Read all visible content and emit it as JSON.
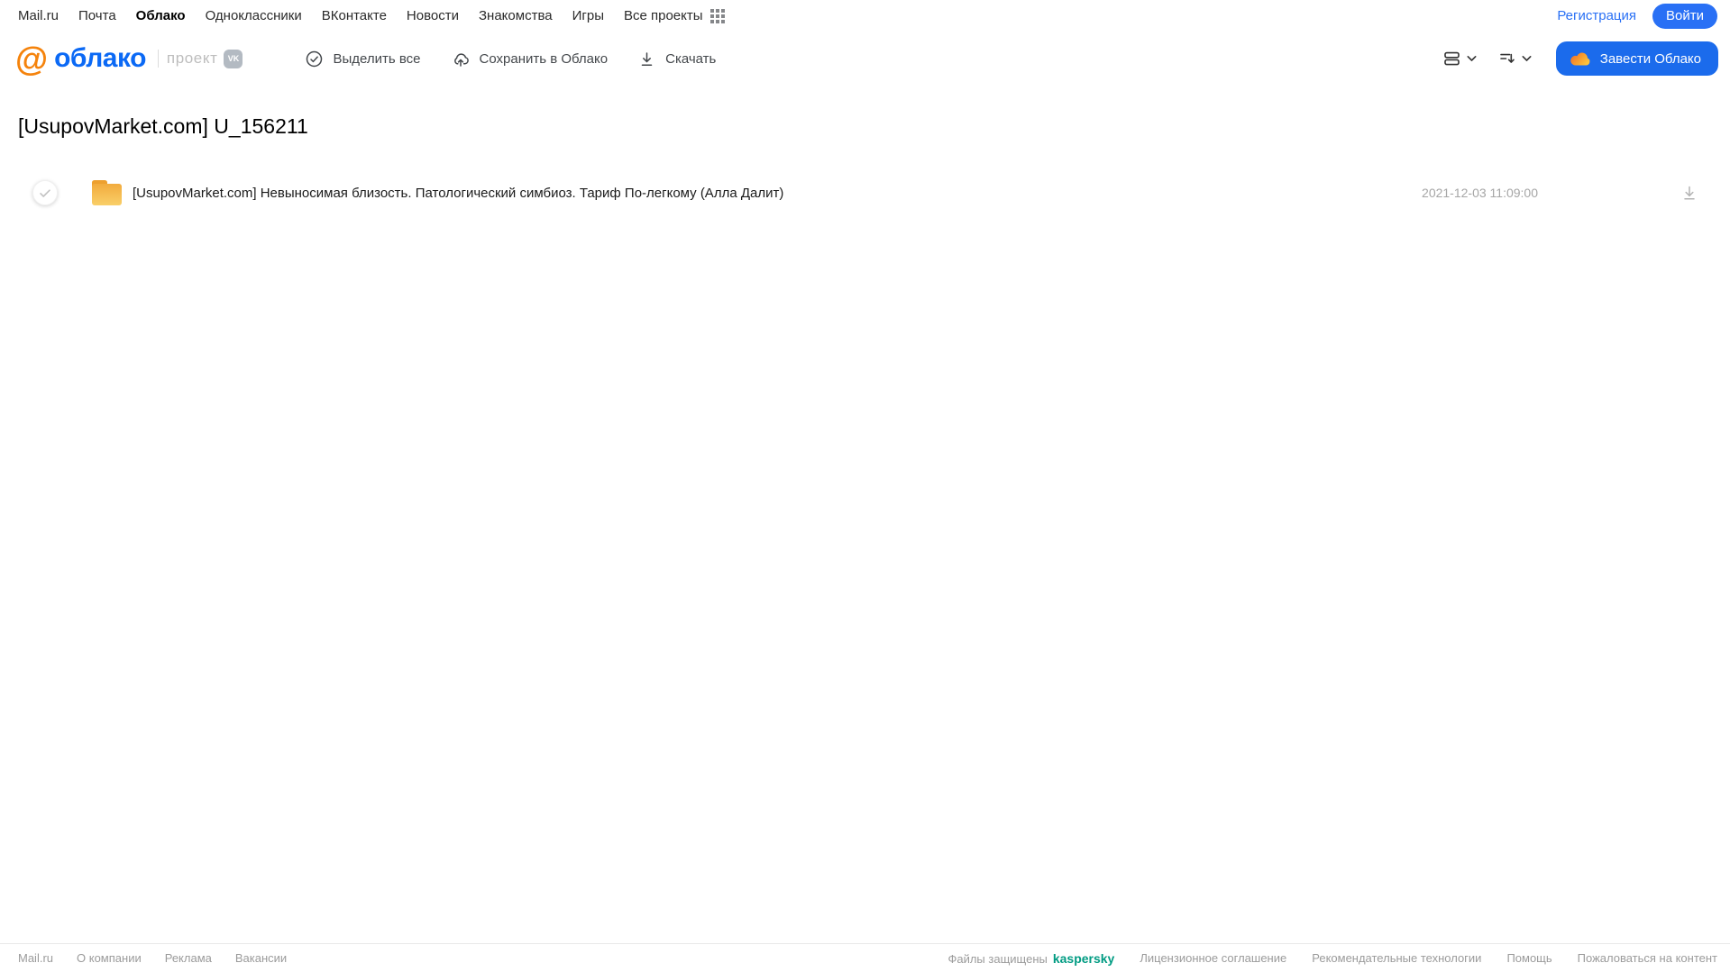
{
  "topnav": {
    "items": [
      {
        "label": "Mail.ru"
      },
      {
        "label": "Почта"
      },
      {
        "label": "Облако"
      },
      {
        "label": "Одноклассники"
      },
      {
        "label": "ВКонтакте"
      },
      {
        "label": "Новости"
      },
      {
        "label": "Знакомства"
      },
      {
        "label": "Игры"
      },
      {
        "label": "Все проекты"
      }
    ],
    "registration_label": "Регистрация",
    "login_label": "Войти"
  },
  "header": {
    "logo_at": "@",
    "logo_text": "облако",
    "project_label": "проект",
    "vk_badge": "VK",
    "toolbar": {
      "select_all_label": "Выделить все",
      "save_to_cloud_label": "Сохранить в Облако",
      "download_label": "Скачать"
    },
    "get_cloud_label": "Завести Облако"
  },
  "main": {
    "title": "[UsupovMarket.com] U_156211",
    "files": [
      {
        "type": "folder",
        "name": "[UsupovMarket.com] Невыносимая близость. Патологический симбиоз. Тариф По-легкому (Алла Далит)",
        "date": "2021-12-03 11:09:00"
      }
    ]
  },
  "footer": {
    "left_links": [
      "Mail.ru",
      "О компании",
      "Реклама",
      "Вакансии"
    ],
    "protected_label": "Файлы защищены",
    "kaspersky_label": "kaspersky",
    "right_links": [
      "Лицензионное соглашение",
      "Рекомендательные технологии",
      "Помощь",
      "Пожаловаться на контент"
    ]
  },
  "icons": {
    "select_all": "check-circle-icon",
    "save_to_cloud": "cloud-upload-icon",
    "download": "download-arrow-icon",
    "view_mode": "list-view-icon",
    "sort": "sort-icon",
    "apps": "apps-grid-icon",
    "folder": "folder-icon",
    "cloud_brand": "cloud-icon"
  },
  "colors": {
    "accent_blue": "#1b6bec",
    "link_blue": "#2970f5",
    "logo_orange": "#f5830c",
    "logo_blue": "#0b69f5",
    "folder_top": "#eda02f",
    "folder_body_light": "#f9cf69",
    "kaspersky_teal": "#009b82",
    "muted_gray": "#9b9b9b"
  }
}
